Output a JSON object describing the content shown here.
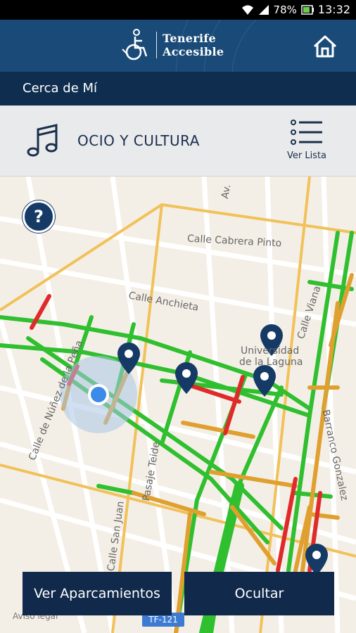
{
  "status_bar": {
    "battery": "78%",
    "time": "13:32"
  },
  "app_bar": {
    "brand_line1": "Tenerife",
    "brand_line2": "Accesible"
  },
  "section": {
    "title": "Cerca de Mí"
  },
  "category": {
    "title": "OCIO Y CULTURA",
    "list_label": "Ver Lista"
  },
  "map": {
    "streets": [
      "Calle Cabrera Pinto",
      "Calle Anchieta",
      "Universidad",
      "de la Laguna",
      "Calle de Núñez de la Peña",
      "Pasaje Teide",
      "Calle San Juan",
      "Barranco Gonzalez",
      "Av. ",
      "Calle Viana"
    ],
    "help": "?",
    "legal": "Aviso legal",
    "road_badge": "TF-121"
  },
  "buttons": {
    "parking": "Ver Aparcamientos",
    "hide": "Ocultar"
  },
  "colors": {
    "accessible": "#2fbf2f",
    "partial": "#e0a030",
    "not_accessible": "#e02a2a",
    "brand_dark": "#11294a"
  }
}
